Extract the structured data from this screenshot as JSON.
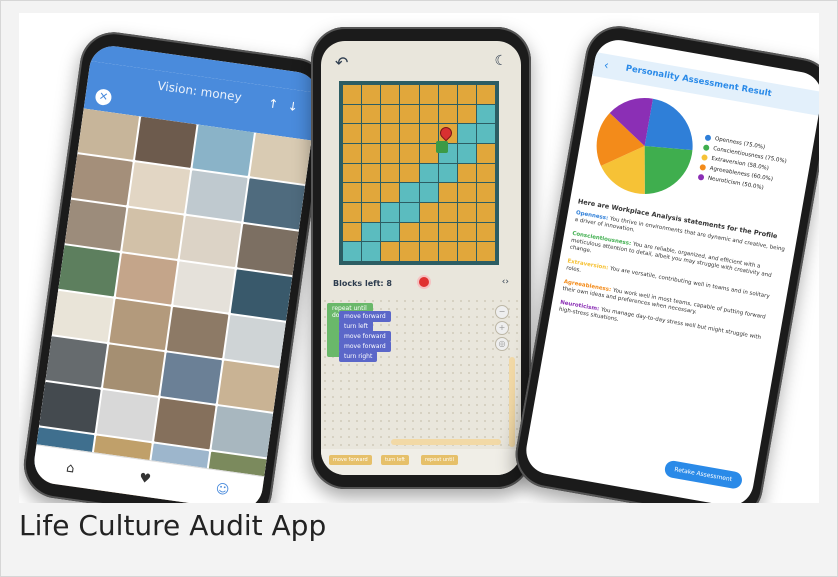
{
  "caption": "Life Culture Audit App",
  "vision_app": {
    "title": "Vision: money",
    "up_icon": "up-arrow-icon",
    "down_icon": "down-arrow-icon",
    "close_icon": "close-icon",
    "nav": [
      "home-icon",
      "favorite-icon",
      "profile-icon"
    ],
    "tile_colors": [
      "#c7b59a",
      "#6d5b4d",
      "#8ab3c8",
      "#d9cbb3",
      "#a48f7a",
      "#e2d6c4",
      "#bfc9cf",
      "#4f6b7e",
      "#9c8c7b",
      "#d2c1a8",
      "#dcd3c6",
      "#7c6f62",
      "#5d7f5e",
      "#c4a58a",
      "#e5e1da",
      "#39596b",
      "#e9e4d8",
      "#b39a7c",
      "#8d7a66",
      "#cfd4d6",
      "#666b6e",
      "#a58f72",
      "#6b8096",
      "#c9b394",
      "#444a4f",
      "#d8d8d8",
      "#85705c",
      "#a8b7bf",
      "#3f6f8e",
      "#c0a06a",
      "#9db6cc",
      "#7b8a5d",
      "#7a5541",
      "#c9a36f",
      "#b7a995",
      "#5e6e7d"
    ]
  },
  "coding_app": {
    "back_icon": "back-arrow-icon",
    "theme_icon": "moon-icon",
    "blocks_left": "Blocks left: 8",
    "code_icon": "code-icon",
    "stop_icon": "stop-icon",
    "path_cells": [
      [
        1,
        7
      ],
      [
        2,
        6
      ],
      [
        2,
        7
      ],
      [
        3,
        5
      ],
      [
        3,
        6
      ],
      [
        4,
        4
      ],
      [
        4,
        5
      ],
      [
        5,
        3
      ],
      [
        5,
        4
      ],
      [
        6,
        2
      ],
      [
        6,
        3
      ],
      [
        7,
        1
      ],
      [
        7,
        2
      ],
      [
        8,
        0
      ],
      [
        8,
        1
      ]
    ],
    "blocks": {
      "repeat": "repeat until",
      "do": "do",
      "move1": "move forward",
      "turn1": "turn left",
      "move2": "move forward",
      "move3": "move forward",
      "turn2": "turn right"
    },
    "toolbox": [
      "move forward",
      "turn left",
      "repeat until"
    ]
  },
  "assessment_app": {
    "title": "Personality Assessment Result",
    "back_icon": "back-arrow-icon",
    "legend": [
      {
        "label": "Openness (75.0%)",
        "color": "#2f7fd8"
      },
      {
        "label": "Conscientiousness (75.0%)",
        "color": "#3fae4e"
      },
      {
        "label": "Extraversion (58.0%)",
        "color": "#f6c236"
      },
      {
        "label": "Agreeableness (60.0%)",
        "color": "#f38b1a"
      },
      {
        "label": "Neuroticism (50.0%)",
        "color": "#8b2fb5"
      }
    ],
    "pie_values": [
      75,
      75,
      58,
      60,
      50
    ],
    "heading": "Here are Workplace Analysis statements for the Profile",
    "statements": [
      {
        "trait": "Openness:",
        "text": "You thrive in environments that are dynamic and creative, being a driver of innovation.",
        "color": "#2f7fd8"
      },
      {
        "trait": "Conscientiousness:",
        "text": "You are reliable, organized, and efficient with a meticulous attention to detail, albeit you may struggle with creativity and change.",
        "color": "#3fae4e"
      },
      {
        "trait": "Extraversion:",
        "text": "You are versatile, contributing well in teams and in solitary roles.",
        "color": "#f6c236"
      },
      {
        "trait": "Agreeableness:",
        "text": "You work well in most teams, capable of putting forward their own ideas and preferences when necessary.",
        "color": "#f38b1a"
      },
      {
        "trait": "Neuroticism:",
        "text": "You manage day-to-day stress well but might struggle with high-stress situations.",
        "color": "#8b2fb5"
      }
    ],
    "retake": "Retake Assessment"
  }
}
